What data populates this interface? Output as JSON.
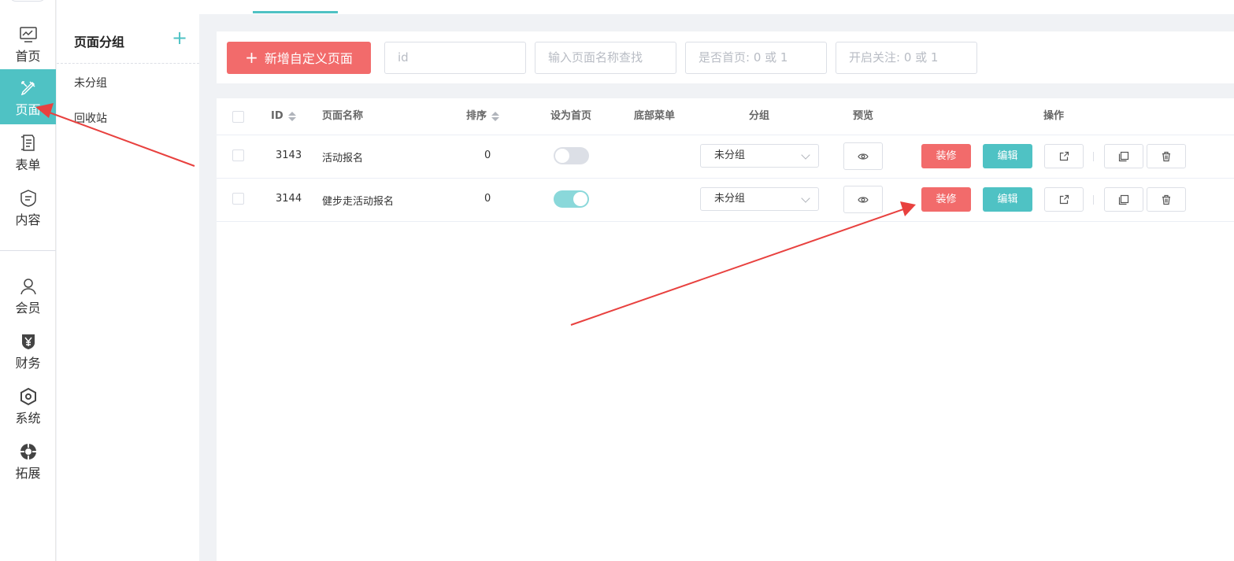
{
  "nav": {
    "items": [
      {
        "label": "首页",
        "icon": "dashboard-icon"
      },
      {
        "label": "页面",
        "icon": "design-icon"
      },
      {
        "label": "表单",
        "icon": "form-icon"
      },
      {
        "label": "内容",
        "icon": "content-icon"
      },
      {
        "label": "会员",
        "icon": "user-icon"
      },
      {
        "label": "财务",
        "icon": "finance-icon"
      },
      {
        "label": "系统",
        "icon": "system-icon"
      },
      {
        "label": "拓展",
        "icon": "extension-icon"
      }
    ],
    "active_index": 1
  },
  "group_panel": {
    "title": "页面分组",
    "add_icon": "plus-icon",
    "items": [
      "未分组",
      "回收站"
    ]
  },
  "toolbar": {
    "new_button": "新增自定义页面",
    "placeholders": {
      "id": "id",
      "name": "输入页面名称查找",
      "is_home": "是否首页: 0 或 1",
      "follow": "开启关注: 0 或 1"
    }
  },
  "table": {
    "headers": {
      "id": "ID",
      "name": "页面名称",
      "sort": "排序",
      "set_home": "设为首页",
      "bottom_menu": "底部菜单",
      "group": "分组",
      "preview": "预览",
      "actions": "操作"
    },
    "rows": [
      {
        "id": "3143",
        "name": "活动报名",
        "sort": "0",
        "is_home": false,
        "group": "未分组",
        "decorate": "装修",
        "edit": "编辑"
      },
      {
        "id": "3144",
        "name": "健步走活动报名",
        "sort": "0",
        "is_home": true,
        "group": "未分组",
        "decorate": "装修",
        "edit": "编辑"
      }
    ]
  },
  "colors": {
    "accent": "#4fc2c4",
    "danger": "#f26b6b",
    "annotation_arrow": "#e8413f"
  }
}
